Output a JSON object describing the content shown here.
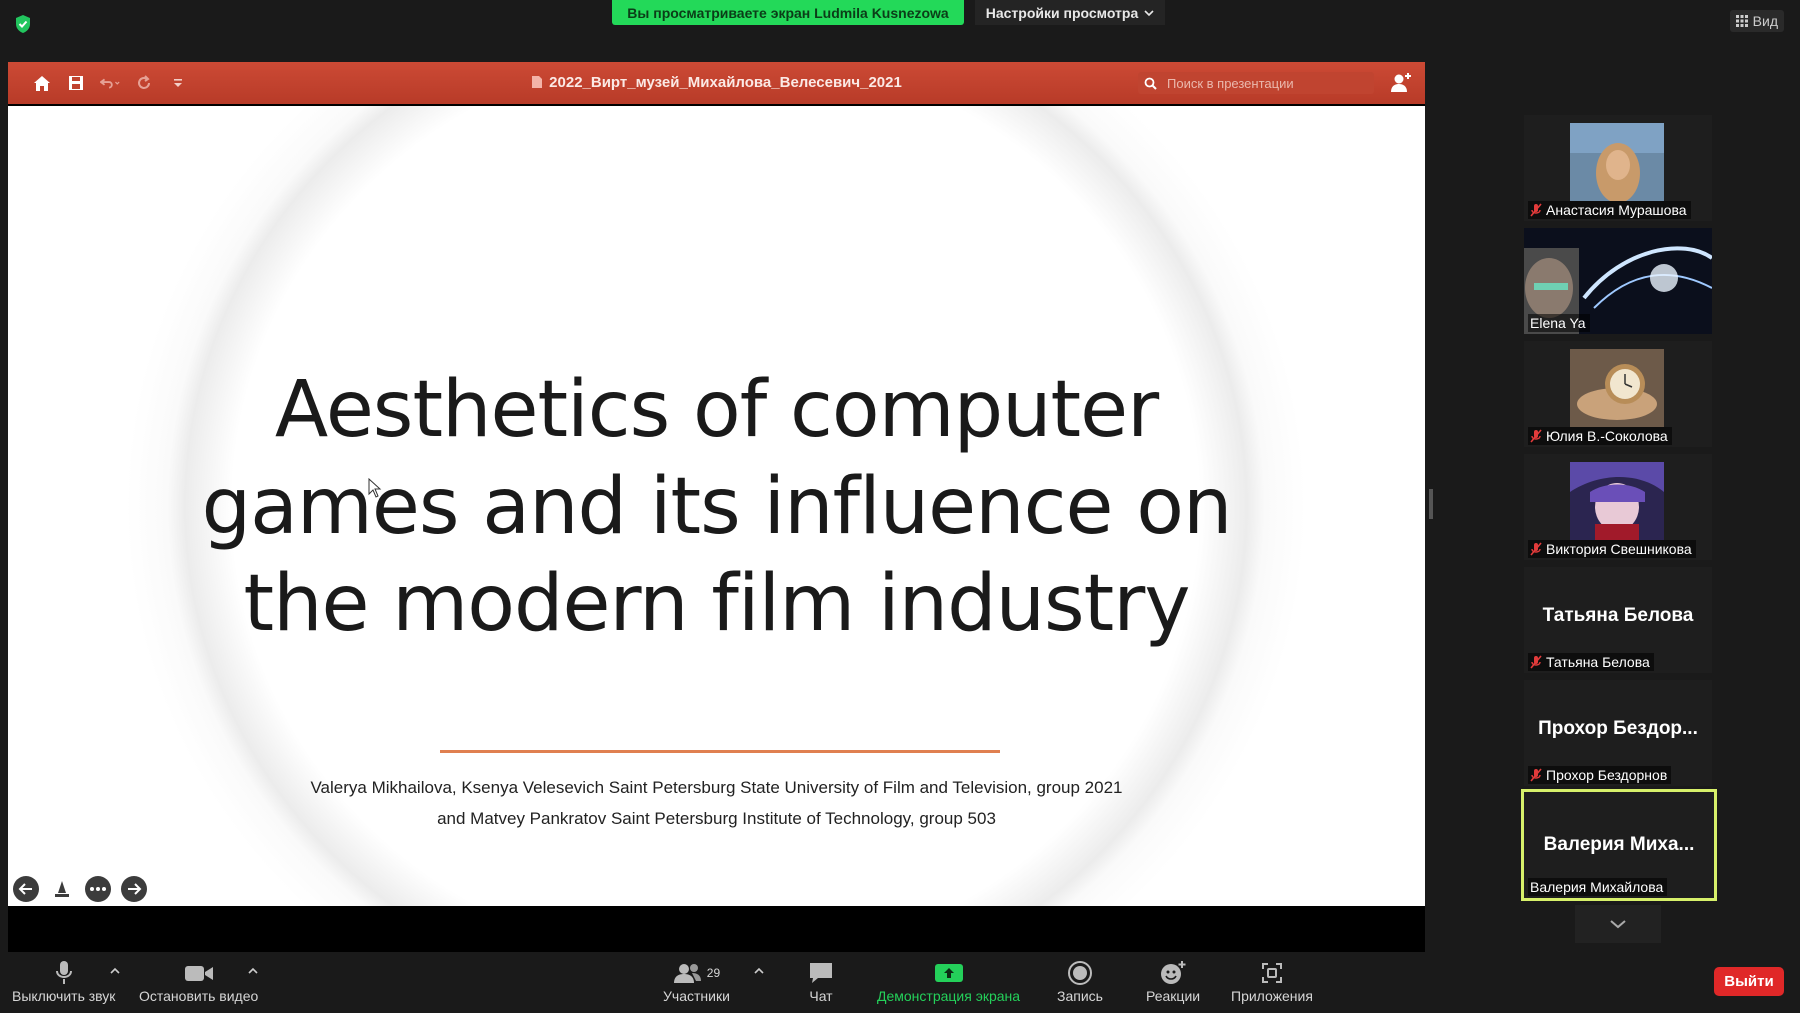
{
  "top_bar": {
    "share_banner": "Вы просматриваете экран Ludmila Kusnezowa",
    "view_settings": "Настройки просмотра",
    "view_button": "Вид"
  },
  "presentation": {
    "file_title": "2022_Вирт_музей_Михайлова_Велесевич_2021",
    "search_placeholder": "Поиск в презентации"
  },
  "slide": {
    "title_line1": "Aesthetics of computer",
    "title_line2": "games and its influence on",
    "title_line3": "the modern film industry",
    "authors_line1": "Valerya Mikhailova, Ksenya Velesevich Saint Petersburg State University of Film and Television, group 2021",
    "authors_line2": "and Matvey Pankratov Saint Petersburg Institute of Technology, group 503"
  },
  "participants": [
    {
      "name": "Анастасия Мурашова",
      "muted": true,
      "video": true
    },
    {
      "name": "Elena Ya",
      "muted": false,
      "video": true
    },
    {
      "name": "Юлия В.-Соколова",
      "muted": true,
      "video": true
    },
    {
      "name": "Виктория Свешникова",
      "muted": true,
      "video": true
    },
    {
      "name": "Татьяна Белова",
      "display": "Татьяна Белова",
      "muted": true,
      "video": false
    },
    {
      "name": "Прохор Бездорнов",
      "display": "Прохор Бездор...",
      "muted": true,
      "video": false
    },
    {
      "name": "Валерия Михайлова",
      "display": "Валерия Миха...",
      "muted": false,
      "video": false,
      "active_speaker": true
    }
  ],
  "toolbar": {
    "mute": "Выключить звук",
    "stop_video": "Остановить видео",
    "participants": "Участники",
    "participants_count": "29",
    "chat": "Чат",
    "share_screen": "Демонстрация экрана",
    "record": "Запись",
    "reactions": "Реакции",
    "apps": "Приложения",
    "leave": "Выйти"
  },
  "colors": {
    "share_green": "#23d959",
    "ppt_red": "#c0432f",
    "active_speaker": "#d7f06a",
    "leave_red": "#e02828"
  }
}
